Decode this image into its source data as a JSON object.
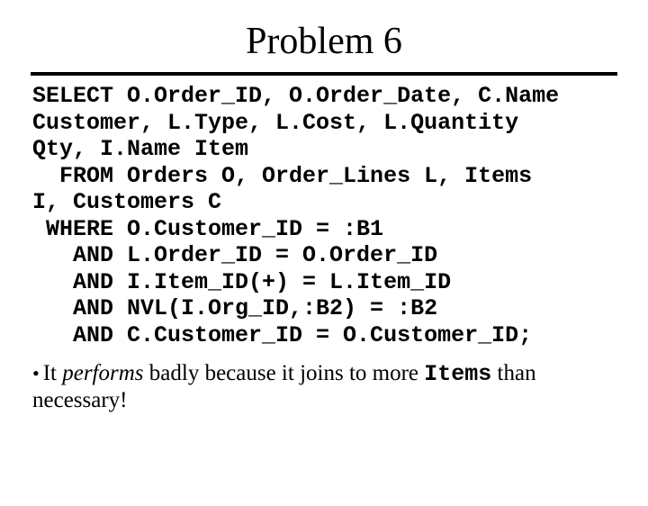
{
  "title": "Problem 6",
  "sql": {
    "l1": "SELECT O.Order_ID, O.Order_Date, C.Name",
    "l2": "Customer, L.Type, L.Cost, L.Quantity",
    "l3": "Qty, I.Name Item",
    "l4": "  FROM Orders O, Order_Lines L, Items",
    "l5": "I, Customers C",
    "l6": " WHERE O.Customer_ID = :B1",
    "l7": "   AND L.Order_ID = O.Order_ID",
    "l8": "   AND I.Item_ID(+) = L.Item_ID",
    "l9": "   AND NVL(I.Org_ID,:B2) = :B2",
    "l10": "   AND C.Customer_ID = O.Customer_ID;"
  },
  "bullet": {
    "dot": "•",
    "seg1": "It ",
    "perf": "performs",
    "seg2": " badly because it joins to more ",
    "code": "Items",
    "seg3": " than necessary!"
  }
}
